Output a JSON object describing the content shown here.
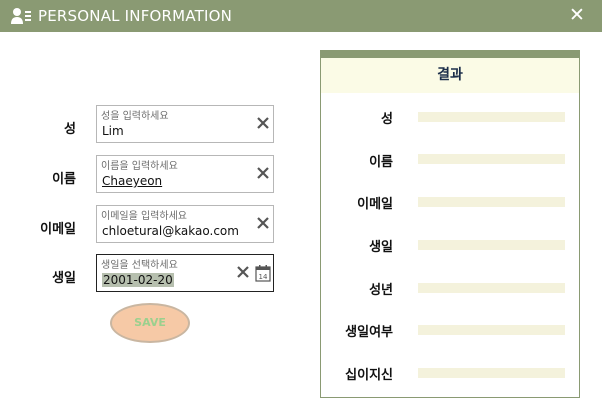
{
  "window": {
    "title": "PERSONAL INFORMATION",
    "close_glyph": "✕"
  },
  "form": {
    "fields": [
      {
        "label": "성",
        "placeholder": "성을 입력하세요",
        "value": "Lim"
      },
      {
        "label": "이름",
        "placeholder": "이름을 입력하세요",
        "value": "Chaeyeon"
      },
      {
        "label": "이메일",
        "placeholder": "이메일을 입력하세요",
        "value": "chloetural@kakao.com"
      },
      {
        "label": "생일",
        "placeholder": "생일을 선택하세요",
        "value": "2001-02-20"
      }
    ],
    "save_label": "SAVE",
    "calendar_day": "14"
  },
  "result": {
    "title": "결과",
    "rows": [
      "성",
      "이름",
      "이메일",
      "생일",
      "성년",
      "생일여부",
      "십이지신"
    ]
  },
  "colors": {
    "titlebar": "#8a9a73",
    "save_fill": "#f6c9a6",
    "save_text": "#9bd08e",
    "result_bar": "#f4f2dc"
  },
  "icons": {
    "app": "user-card-icon",
    "clear": "x-clear-icon",
    "calendar": "calendar-icon",
    "close": "close-icon"
  }
}
